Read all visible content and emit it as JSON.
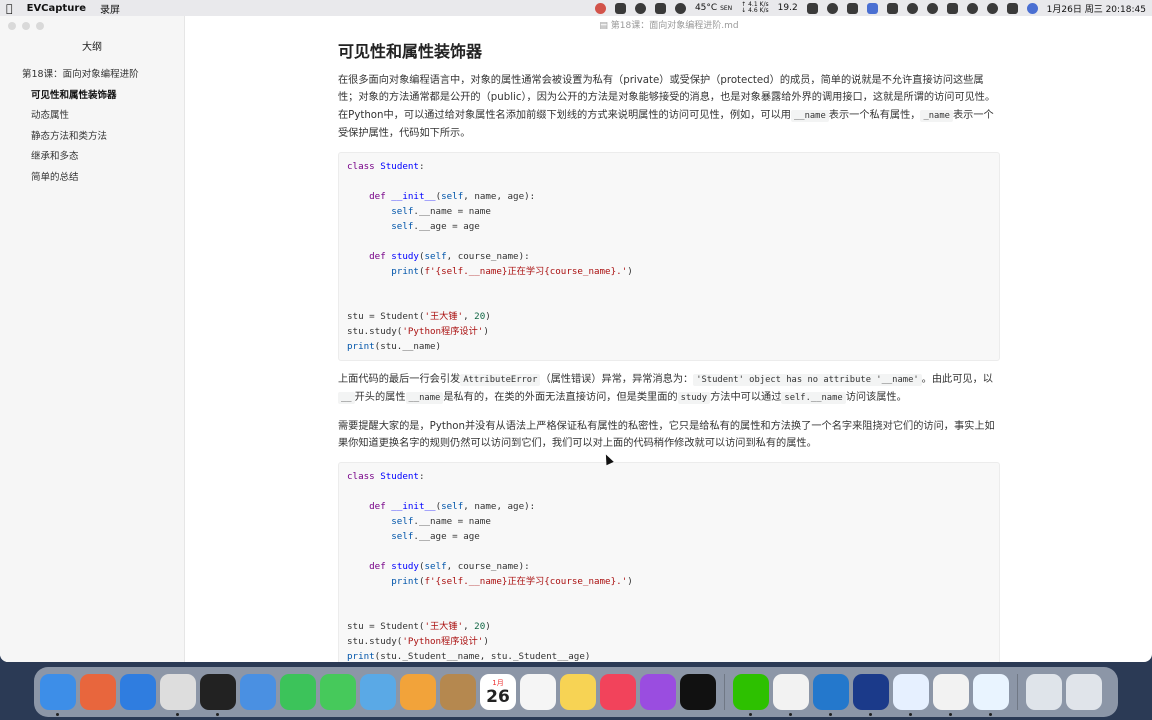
{
  "menubar": {
    "app_name": "EVCapture",
    "menu_item": "录屏",
    "temp": "45°C",
    "temp_sub": "SEN",
    "net_up": "↑ 4.1 K/s",
    "net_down": "↓ 4.6 K/s",
    "battery_pct": "19.2",
    "datetime": "1月26日 周三  20:18:45"
  },
  "window": {
    "title": "第18课：面向对象编程进阶.md"
  },
  "sidebar": {
    "heading": "大纲",
    "items": [
      {
        "label": "第18课：面向对象编程进阶",
        "level": 1,
        "active": false
      },
      {
        "label": "可见性和属性装饰器",
        "level": 2,
        "active": true
      },
      {
        "label": "动态属性",
        "level": 2,
        "active": false
      },
      {
        "label": "静态方法和类方法",
        "level": 2,
        "active": false
      },
      {
        "label": "继承和多态",
        "level": 2,
        "active": false
      },
      {
        "label": "简单的总结",
        "level": 2,
        "active": false
      }
    ]
  },
  "doc": {
    "heading": "可见性和属性装饰器",
    "para1": {
      "t1": "在很多面向对象编程语言中，对象的属性通常会被设置为私有（private）或受保护（protected）的成员，简单的说就是不允许直接访问这些属性；对象的方法通常都是公开的（public），因为公开的方法是对象能够接受的消息，也是对象暴露给外界的调用接口，这就是所谓的访问可见性。在Python中，可以通过给对象属性名添加前缀下划线的方式来说明属性的访问可见性，例如，可以用",
      "c1": "__name",
      "t2": "表示一个私有属性，",
      "c2": "_name",
      "t3": "表示一个受保护属性，代码如下所示。"
    },
    "code1": {
      "l1_kw": "class",
      "l1_name": "Student",
      "l1_rest": ":",
      "l3_kw": "def",
      "l3_fn": "__init__",
      "l3_self": "self",
      "l3_rest": ", name, age):",
      "l4_self": "self",
      "l4_rest": ".__name = name",
      "l5_self": "self",
      "l5_rest": ".__age = age",
      "l7_kw": "def",
      "l7_fn": "study",
      "l7_self": "self",
      "l7_rest": ", course_name):",
      "l8_fn": "print",
      "l8_str": "f'{self.__name}正在学习{course_name}.'",
      "l11_a": "stu = Student(",
      "l11_str": "'王大锤'",
      "l11_num": "20",
      "l12_a": "stu.study(",
      "l12_str": "'Python程序设计'",
      "l13_fn": "print",
      "l13_rest": "(stu.__name)"
    },
    "para2": {
      "t1": "上面代码的最后一行会引发",
      "c1": "AttributeError",
      "t2": "（属性错误）异常，异常消息为：",
      "c2": "'Student' object has no attribute '__name'",
      "t3": "。由此可见，以",
      "c3": "__",
      "t4": "开头的属性",
      "c4": "__name",
      "t5": "是私有的，在类的外面无法直接访问，但是类里面的",
      "c5": "study",
      "t6": "方法中可以通过",
      "c6": "self.__name",
      "t7": "访问该属性。"
    },
    "para3": "需要提醒大家的是，Python并没有从语法上严格保证私有属性的私密性，它只是给私有的属性和方法换了一个名字来阻挠对它们的访问，事实上如果你知道更换名字的规则仍然可以访问到它们，我们可以对上面的代码稍作修改就可以访问到私有的属性。",
    "code2": {
      "l13_rest": "(stu._Student__name, stu._Student__age)"
    }
  },
  "dock": {
    "calendar_month": "1月",
    "calendar_day": "26",
    "apps": [
      {
        "name": "finder",
        "color": "#3d8ee8"
      },
      {
        "name": "launchpad",
        "color": "#e8663d"
      },
      {
        "name": "safari",
        "color": "#2f7de0"
      },
      {
        "name": "chrome",
        "color": "#dddddd"
      },
      {
        "name": "terminal",
        "color": "#222222"
      },
      {
        "name": "mail",
        "color": "#4a90e2"
      },
      {
        "name": "facetime",
        "color": "#3cc35a"
      },
      {
        "name": "messages",
        "color": "#46c95b"
      },
      {
        "name": "maps",
        "color": "#5aa9e6"
      },
      {
        "name": "photos",
        "color": "#f2a33a"
      },
      {
        "name": "contacts",
        "color": "#b5884f"
      },
      {
        "name": "calendar",
        "color": "#ffffff"
      },
      {
        "name": "reminders",
        "color": "#f5f5f5"
      },
      {
        "name": "notes",
        "color": "#f7d354"
      },
      {
        "name": "music",
        "color": "#f2435b"
      },
      {
        "name": "podcasts",
        "color": "#9a4de0"
      },
      {
        "name": "apple-tv",
        "color": "#111111"
      },
      {
        "name": "wechat",
        "color": "#2dc100"
      },
      {
        "name": "typora",
        "color": "#f2f2f2"
      },
      {
        "name": "vscode",
        "color": "#2478cc"
      },
      {
        "name": "capture",
        "color": "#1b3a8a"
      },
      {
        "name": "qq-browser",
        "color": "#e6f0ff"
      },
      {
        "name": "qq",
        "color": "#f2f2f2"
      },
      {
        "name": "pycharm",
        "color": "#e9f4ff"
      },
      {
        "name": "downloads",
        "color": "#dfe4ea"
      },
      {
        "name": "trash",
        "color": "#e0e4ea"
      }
    ]
  }
}
